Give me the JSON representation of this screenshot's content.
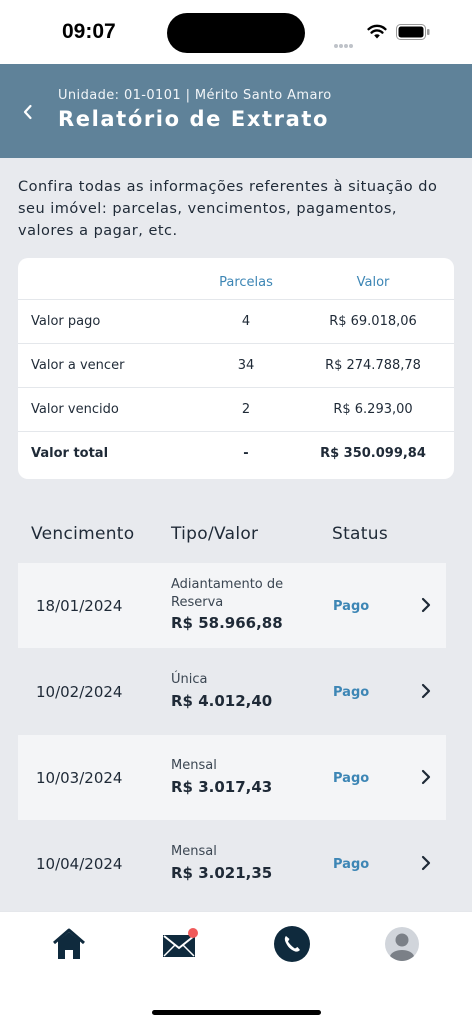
{
  "status_bar": {
    "time": "09:07"
  },
  "header": {
    "unit_line": "Unidade: 01-0101 | Mérito Santo Amaro",
    "title": "Relatório de Extrato"
  },
  "intro": "Confira todas as informações referentes à situação do seu imóvel: parcelas, vencimentos, pagamentos, valores a pagar, etc.",
  "summary": {
    "headers": [
      "",
      "Parcelas",
      "Valor"
    ],
    "rows": [
      {
        "label": "Valor pago",
        "parcelas": "4",
        "valor": "R$ 69.018,06"
      },
      {
        "label": "Valor a vencer",
        "parcelas": "34",
        "valor": "R$ 274.788,78"
      },
      {
        "label": "Valor vencido",
        "parcelas": "2",
        "valor": "R$ 6.293,00"
      },
      {
        "label": "Valor total",
        "parcelas": "-",
        "valor": "R$ 350.099,84"
      }
    ]
  },
  "list": {
    "headers": [
      "Vencimento",
      "Tipo/Valor",
      "Status"
    ],
    "items": [
      {
        "date": "18/01/2024",
        "tipo_line1": "Adiantamento de",
        "tipo_line2": "Reserva",
        "valor": "R$ 58.966,88",
        "status": "Pago"
      },
      {
        "date": "10/02/2024",
        "tipo_line1": "Única",
        "tipo_line2": "",
        "valor": "R$ 4.012,40",
        "status": "Pago"
      },
      {
        "date": "10/03/2024",
        "tipo_line1": "Mensal",
        "tipo_line2": "",
        "valor": "R$ 3.017,43",
        "status": "Pago"
      },
      {
        "date": "10/04/2024",
        "tipo_line1": "Mensal",
        "tipo_line2": "",
        "valor": "R$ 3.021,35",
        "status": "Pago"
      }
    ]
  },
  "tabbar": {
    "icons": [
      "home-icon",
      "mail-icon",
      "phone-icon",
      "profile-icon"
    ],
    "active_color": "#0f2a3d",
    "badge_color": "#f05a5a"
  },
  "colors": {
    "header_bg": "#5f8299",
    "accent": "#3d86b5",
    "page_bg": "#e8eaee"
  }
}
